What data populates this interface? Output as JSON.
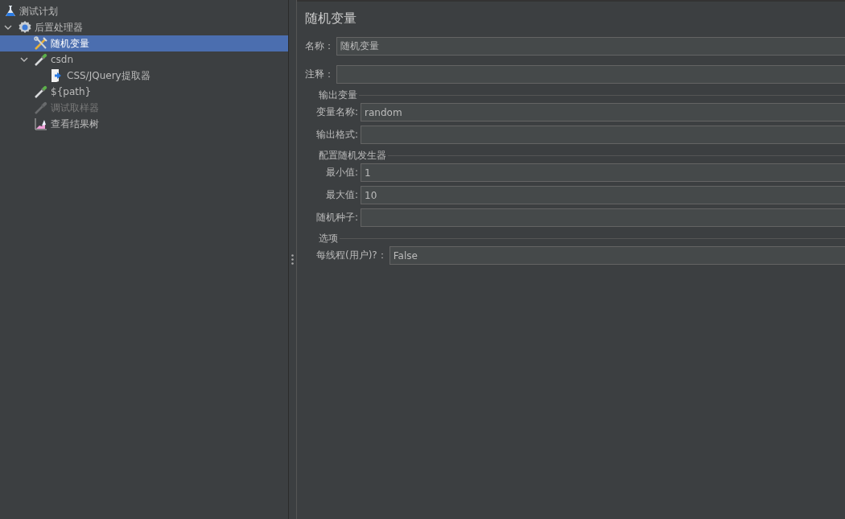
{
  "tree": {
    "label": "测试计划",
    "kind": "plan",
    "selected": false,
    "disabled": false,
    "children": [
      {
        "label": "后置处理器",
        "kind": "group",
        "expanded": true,
        "selected": false,
        "disabled": false,
        "children": [
          {
            "label": "随机变量",
            "kind": "config",
            "selected": true,
            "disabled": false
          },
          {
            "label": "csdn",
            "kind": "extractor",
            "expanded": true,
            "selected": false,
            "disabled": false,
            "children": [
              {
                "label": "CSS/JQuery提取器",
                "kind": "document",
                "selected": false,
                "disabled": false
              }
            ]
          },
          {
            "label": "${path}",
            "kind": "extractor",
            "selected": false,
            "disabled": false
          },
          {
            "label": "调试取样器",
            "kind": "extractor",
            "selected": false,
            "disabled": true
          },
          {
            "label": "查看结果树",
            "kind": "listener",
            "selected": false,
            "disabled": false
          }
        ]
      }
    ]
  },
  "panel": {
    "title": "随机变量",
    "name": {
      "label": "名称：",
      "value": "随机变量"
    },
    "comment": {
      "label": "注释："
    },
    "sections": [
      {
        "title": "输出变量",
        "fields": [
          {
            "label": "变量名称:",
            "value": "random"
          },
          {
            "label": "输出格式:"
          }
        ]
      },
      {
        "title": "配置随机发生器",
        "fields": [
          {
            "label": "最小值:",
            "value": "1"
          },
          {
            "label": "最大值:",
            "value": "10"
          },
          {
            "label": "随机种子:"
          }
        ]
      },
      {
        "title": "选项",
        "fields": [
          {
            "label": "每线程(用户)?：",
            "value": "False"
          }
        ]
      }
    ]
  }
}
